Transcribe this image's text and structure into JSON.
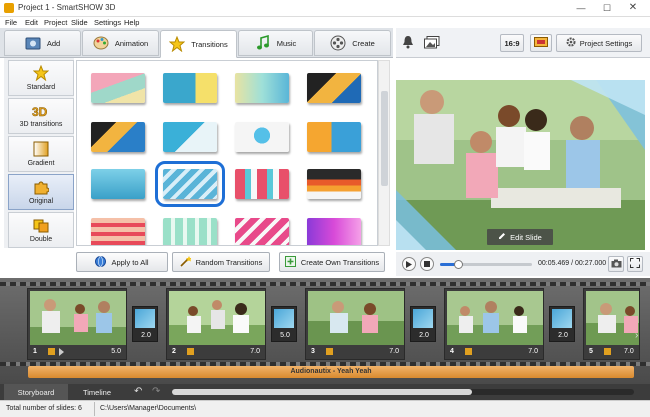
{
  "window": {
    "title": "Project 1 - SmartSHOW 3D"
  },
  "menu": [
    "File",
    "Edit",
    "Project",
    "Slide",
    "Settings",
    "Help"
  ],
  "tabs": [
    {
      "label": "Add",
      "icon": "add-photo-icon"
    },
    {
      "label": "Animation",
      "icon": "palette-icon"
    },
    {
      "label": "Transitions",
      "icon": "star-icon",
      "active": true
    },
    {
      "label": "Music",
      "icon": "music-note-icon"
    },
    {
      "label": "Create",
      "icon": "film-reel-icon"
    }
  ],
  "right_toolbar": {
    "aspect": "16:9",
    "project_settings": "Project Settings"
  },
  "categories": [
    {
      "label": "Standard",
      "icon": "star-icon"
    },
    {
      "label": "3D transitions",
      "icon": "3d-icon"
    },
    {
      "label": "Gradient",
      "icon": "gradient-icon"
    },
    {
      "label": "Original",
      "icon": "puzzle-icon",
      "active": true
    },
    {
      "label": "Double",
      "icon": "double-icon"
    }
  ],
  "actions": {
    "apply_all": "Apply to All",
    "random": "Random Transitions",
    "create_own": "Create Own Transitions"
  },
  "preview": {
    "edit_slide": "Edit Slide",
    "time": "00:05.469 / 00:27.000",
    "progress": 0.2
  },
  "slides": [
    {
      "num": "1",
      "dur": "5.0"
    },
    {
      "num": "2",
      "dur": "7.0"
    },
    {
      "num": "3",
      "dur": "7.0"
    },
    {
      "num": "4",
      "dur": "7.0"
    },
    {
      "num": "5",
      "dur": "7.0"
    }
  ],
  "transitions": [
    "2.0",
    "5.0",
    "2.0",
    "2.0"
  ],
  "audio": "Audionautix - Yeah Yeah",
  "bottom_tabs": [
    "Storyboard",
    "Timeline"
  ],
  "status": {
    "total": "Total number of slides: 6",
    "path": "C:\\Users\\Manager\\Documents\\"
  },
  "colors": {
    "accent": "#1e6fd6",
    "audio": "#e09a45"
  }
}
